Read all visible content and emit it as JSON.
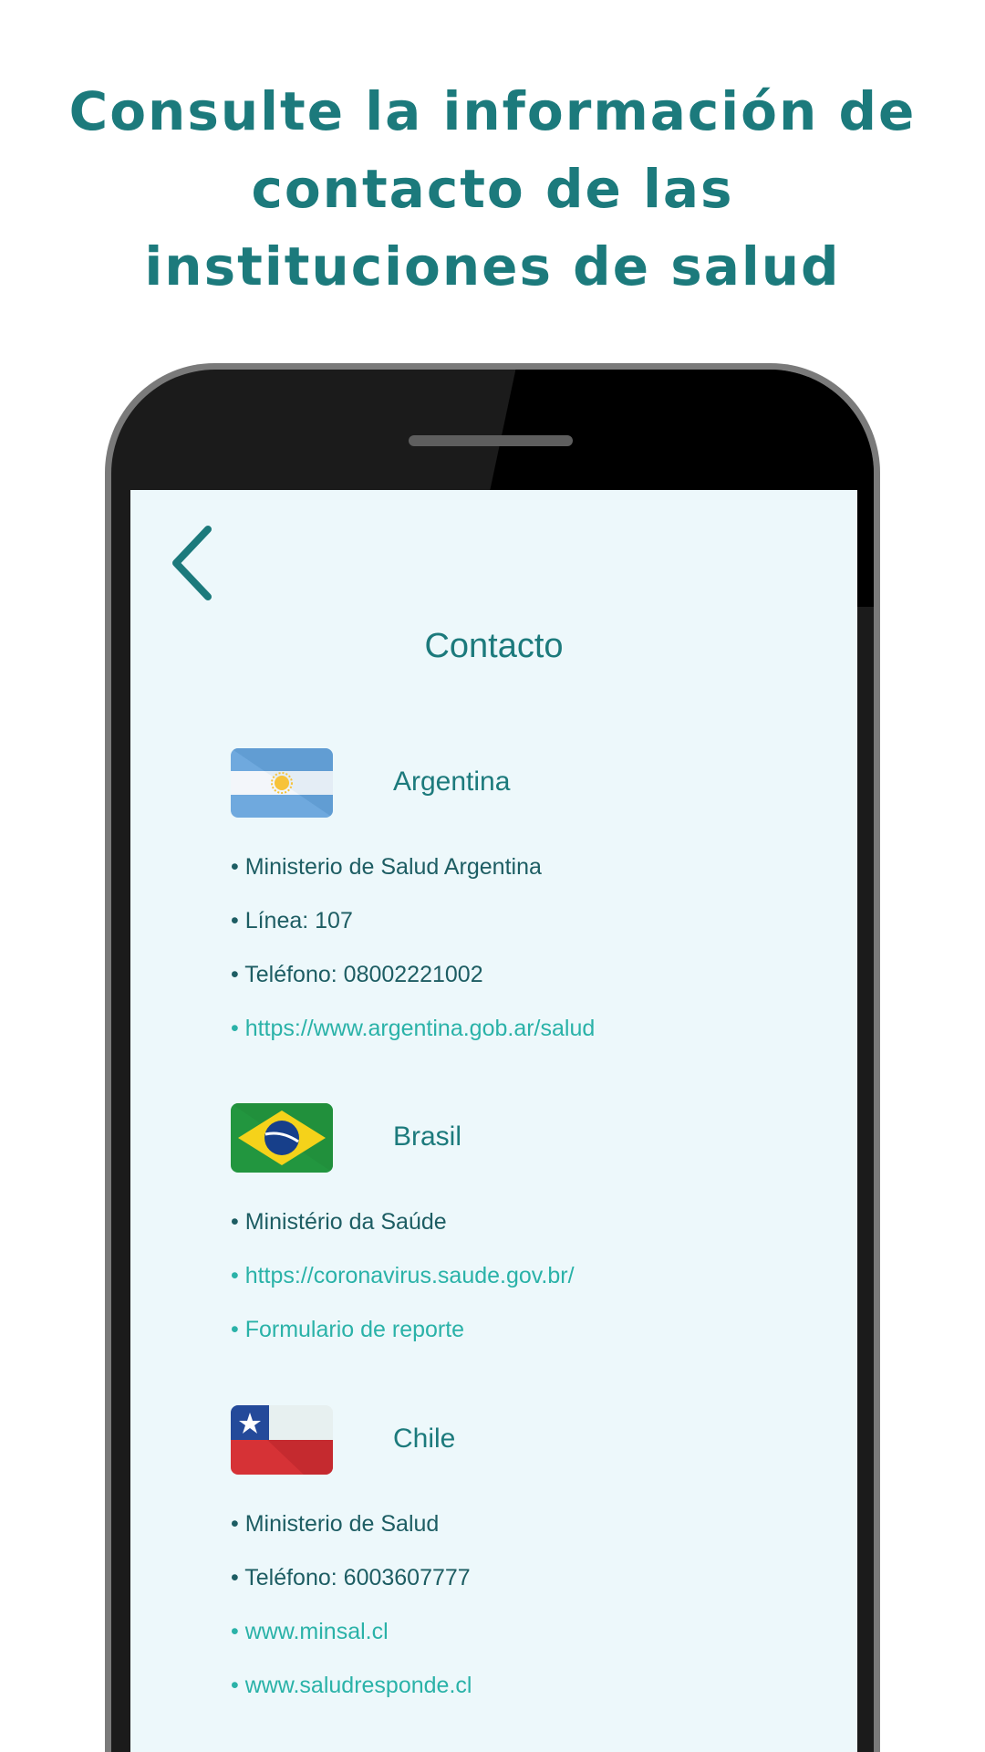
{
  "headline": {
    "line1": "Consulte la información de",
    "line2": "contacto de las",
    "line3": "instituciones de salud"
  },
  "screen": {
    "title": "Contacto",
    "back_icon": "chevron-left-icon"
  },
  "countries": [
    {
      "name": "Argentina",
      "flag_icon": "argentina-flag-icon",
      "items": [
        {
          "text": "Ministerio de Salud Argentina",
          "type": "text"
        },
        {
          "text": "Línea: 107",
          "type": "text"
        },
        {
          "text": "Teléfono: 08002221002",
          "type": "text"
        },
        {
          "text": "https://www.argentina.gob.ar/salud",
          "type": "link"
        }
      ]
    },
    {
      "name": "Brasil",
      "flag_icon": "brazil-flag-icon",
      "items": [
        {
          "text": "Ministério da Saúde",
          "type": "text"
        },
        {
          "text": "https://coronavirus.saude.gov.br/",
          "type": "link"
        },
        {
          "text": "Formulario de reporte",
          "type": "link"
        }
      ]
    },
    {
      "name": "Chile",
      "flag_icon": "chile-flag-icon",
      "items": [
        {
          "text": "Ministerio de Salud",
          "type": "text"
        },
        {
          "text": "Teléfono: 6003607777",
          "type": "text"
        },
        {
          "text": "www.minsal.cl",
          "type": "link"
        },
        {
          "text": "www.saludresponde.cl",
          "type": "link"
        }
      ]
    }
  ],
  "colors": {
    "accent": "#1c7a7c",
    "link": "#2ab2a8",
    "text": "#1d5d63",
    "screen_bg": "#edf8fb"
  }
}
